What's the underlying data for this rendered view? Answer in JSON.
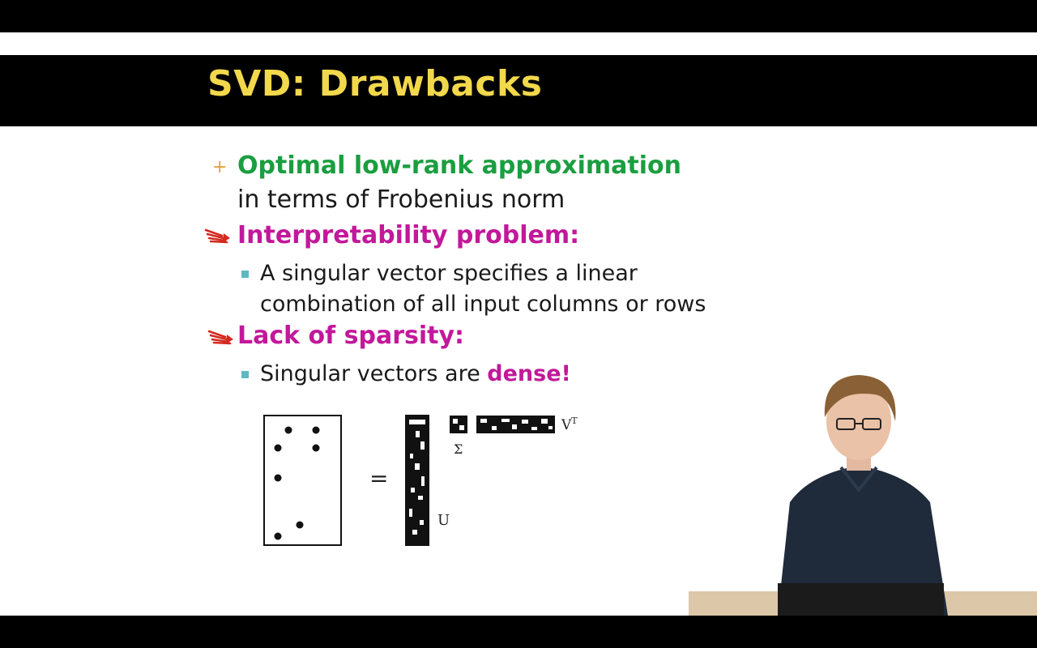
{
  "slide": {
    "title": "SVD: Drawbacks",
    "bullets": [
      {
        "marker": "+",
        "heading": "Optimal low-rank approximation",
        "continuation": "in terms of Frobenius norm"
      },
      {
        "marker": "squiggle-arrow",
        "heading": "Interpretability problem:",
        "sub": [
          "A singular vector specifies a linear",
          "combination of all input columns or rows"
        ]
      },
      {
        "marker": "squiggle-arrow",
        "heading": "Lack of sparsity:",
        "sub_prefix": "Singular vectors are ",
        "sub_emph": "dense!"
      }
    ],
    "diagram": {
      "equals": "=",
      "u_label": "U",
      "sigma_label": "Σ",
      "vt_label": "V",
      "vt_sup": "T"
    }
  },
  "colors": {
    "title": "#f2d84b",
    "green": "#1a9e3f",
    "magenta": "#c2189a",
    "bullet_square": "#5db8c2",
    "plus": "#e0a43a",
    "squiggle": "#d42a1f"
  }
}
